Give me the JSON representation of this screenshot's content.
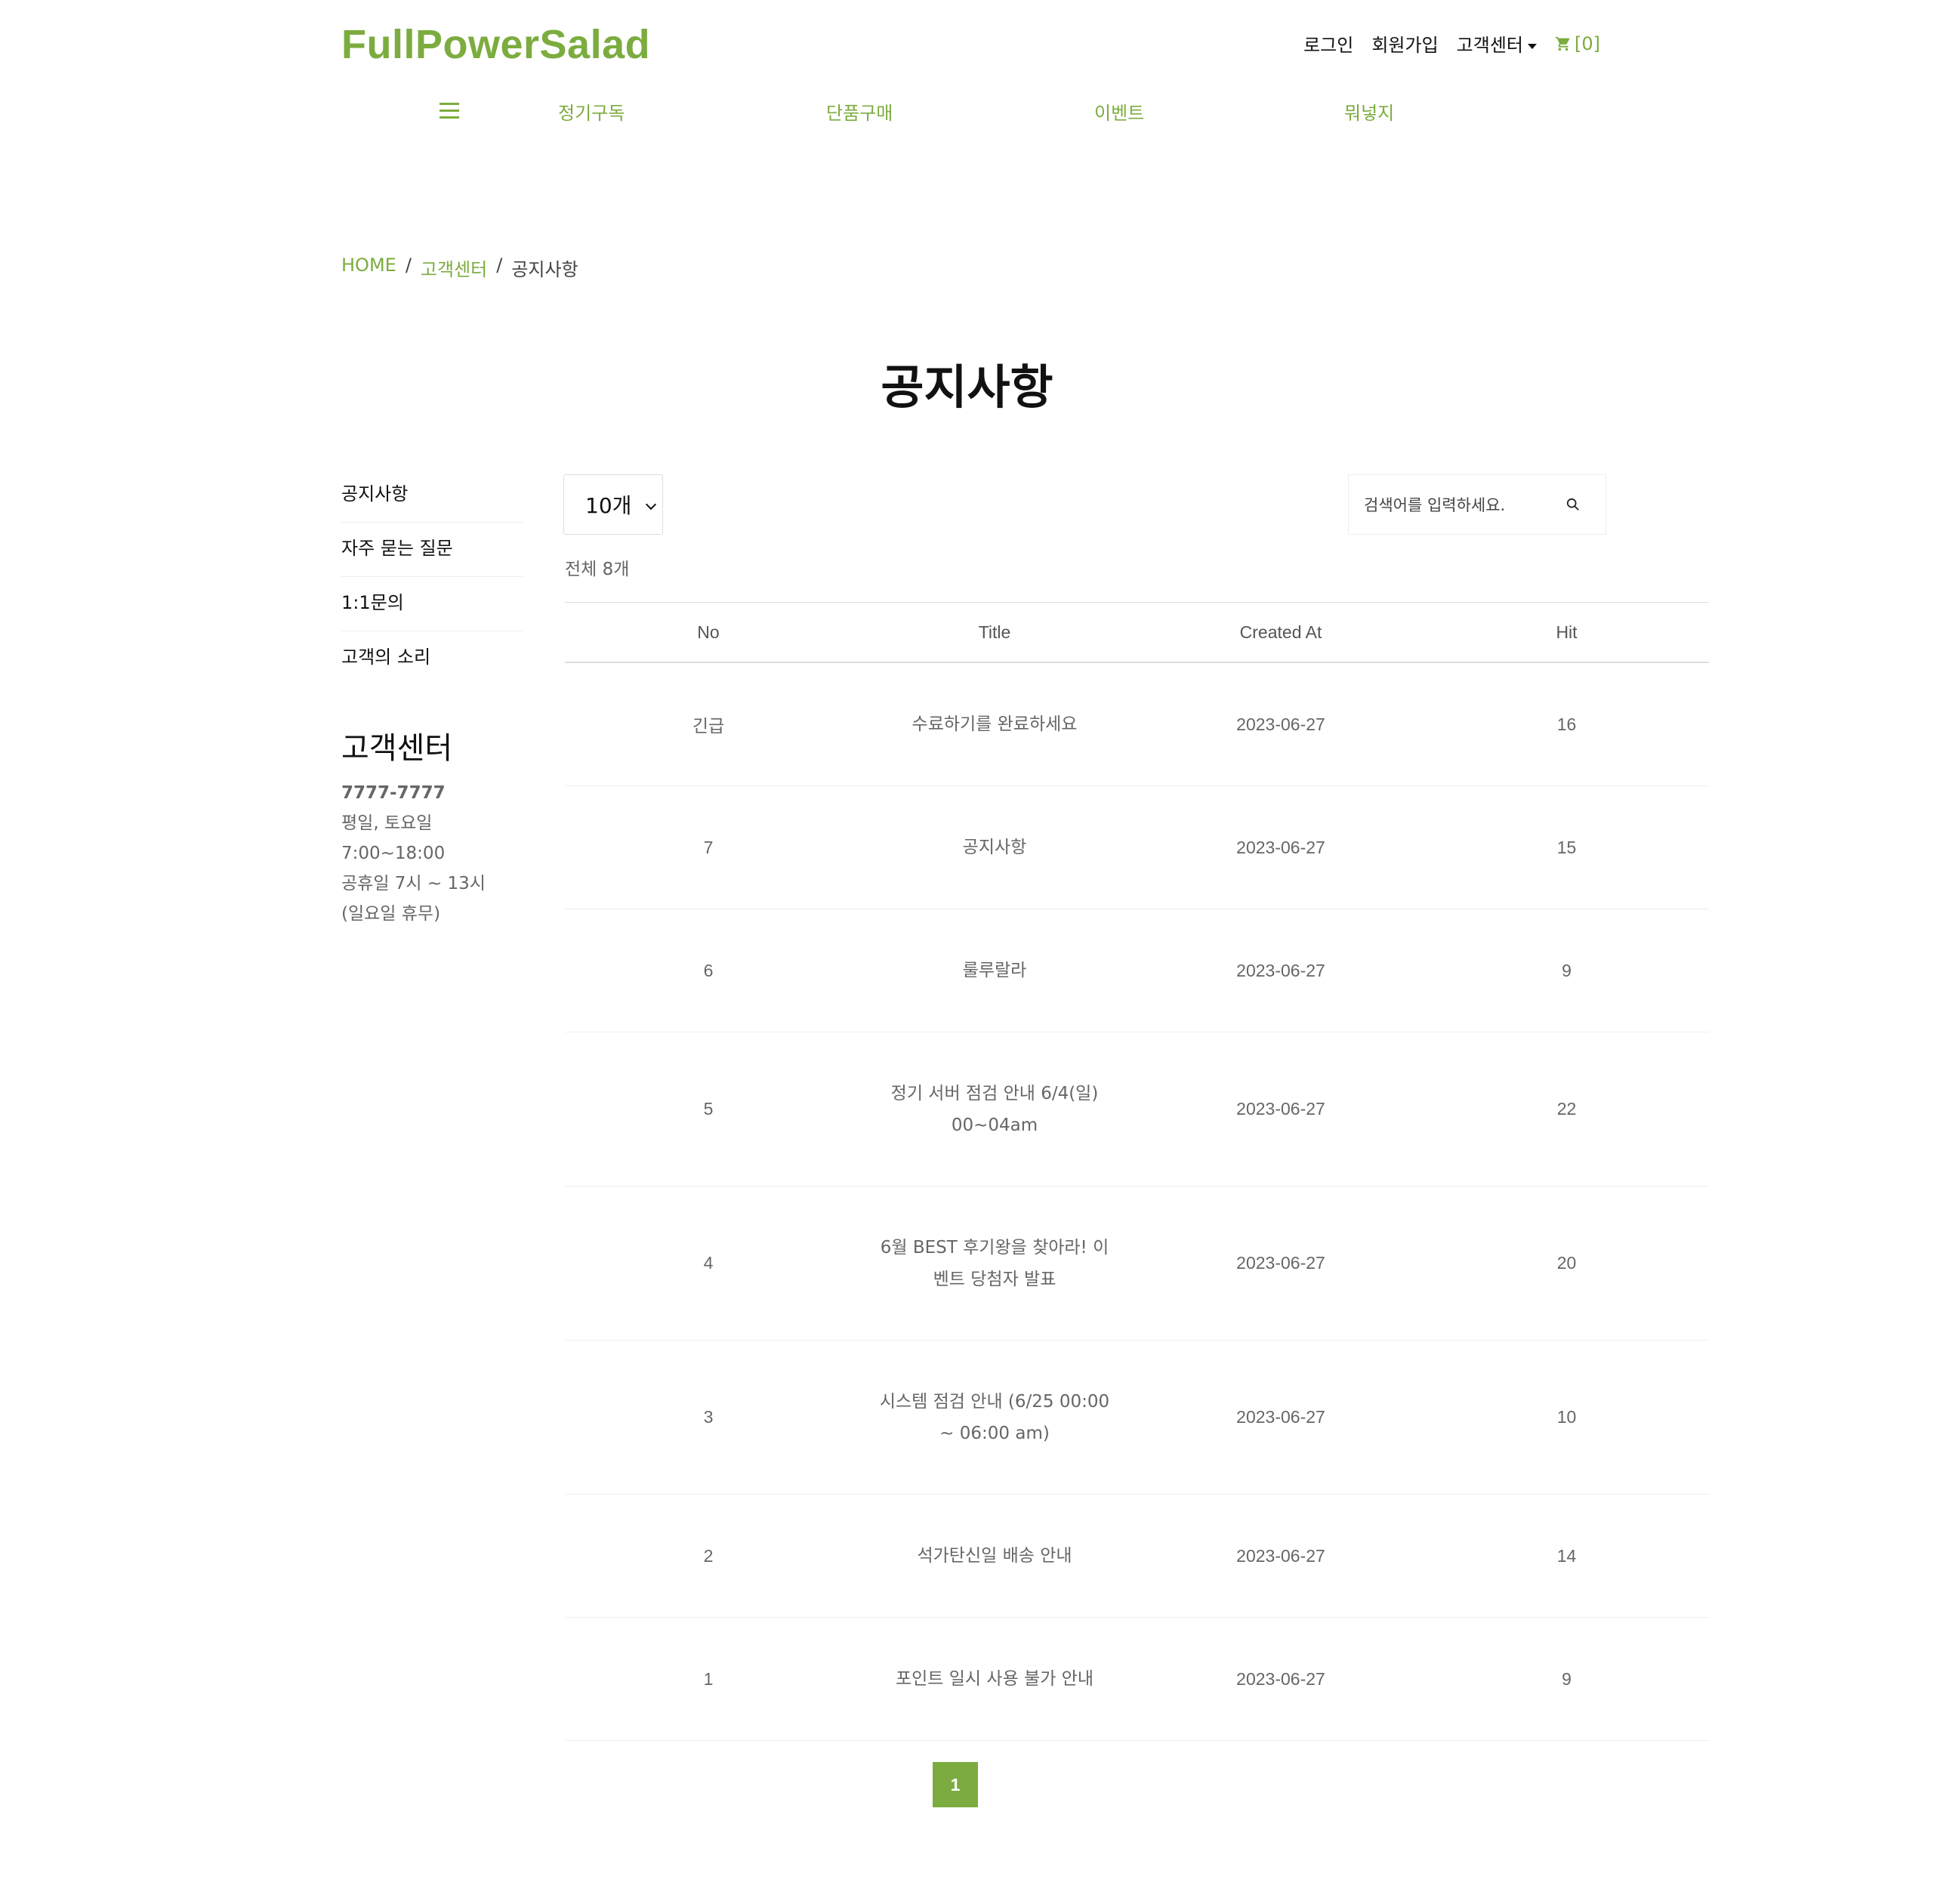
{
  "brand": {
    "logo": "FullPowerSalad",
    "accent": "#7cac3f"
  },
  "topnav": {
    "login": "로그인",
    "signup": "회원가입",
    "support": "고객센터",
    "cart": "[0]"
  },
  "menu": {
    "items": [
      "정기구독",
      "단품구매",
      "이벤트",
      "뭐넣지"
    ]
  },
  "breadcrumb": {
    "home": "HOME",
    "section": "고객센터",
    "current": "공지사항",
    "separator": "/"
  },
  "page": {
    "title": "공지사항"
  },
  "sidebar": {
    "items": [
      "공지사항",
      "자주 묻는 질문",
      "1:1문의",
      "고객의 소리"
    ],
    "cs_title": "고객센터",
    "phone": "7777-7777",
    "hours_line1": "평일, 토요일",
    "hours_line2": "7:00~18:00",
    "hours_line3": "공휴일 7시 ~ 13시",
    "hours_line4": "(일요일 휴무)"
  },
  "controls": {
    "per_page": "10개",
    "search_placeholder": "검색어를 입력하세요.",
    "total": "전체 8개"
  },
  "table": {
    "headers": [
      "No",
      "Title",
      "Created At",
      "Hit"
    ],
    "rows": [
      {
        "no": "긴급",
        "title": "수료하기를 완료하세요",
        "date": "2023-06-27",
        "hit": "16"
      },
      {
        "no": "7",
        "title": "공지사항",
        "date": "2023-06-27",
        "hit": "15"
      },
      {
        "no": "6",
        "title": "룰루랄라",
        "date": "2023-06-27",
        "hit": "9"
      },
      {
        "no": "5",
        "title": "정기 서버 점검 안내 6/4(일) 00~04am",
        "date": "2023-06-27",
        "hit": "22"
      },
      {
        "no": "4",
        "title": "6월 BEST 후기왕을 찾아라! 이벤트 당첨자 발표",
        "date": "2023-06-27",
        "hit": "20"
      },
      {
        "no": "3",
        "title": "시스템 점검 안내 (6/25 00:00 ~ 06:00 am)",
        "date": "2023-06-27",
        "hit": "10"
      },
      {
        "no": "2",
        "title": "석가탄신일 배송 안내",
        "date": "2023-06-27",
        "hit": "14"
      },
      {
        "no": "1",
        "title": "포인트 일시 사용 불가 안내",
        "date": "2023-06-27",
        "hit": "9"
      }
    ]
  },
  "pagination": {
    "current": "1"
  }
}
